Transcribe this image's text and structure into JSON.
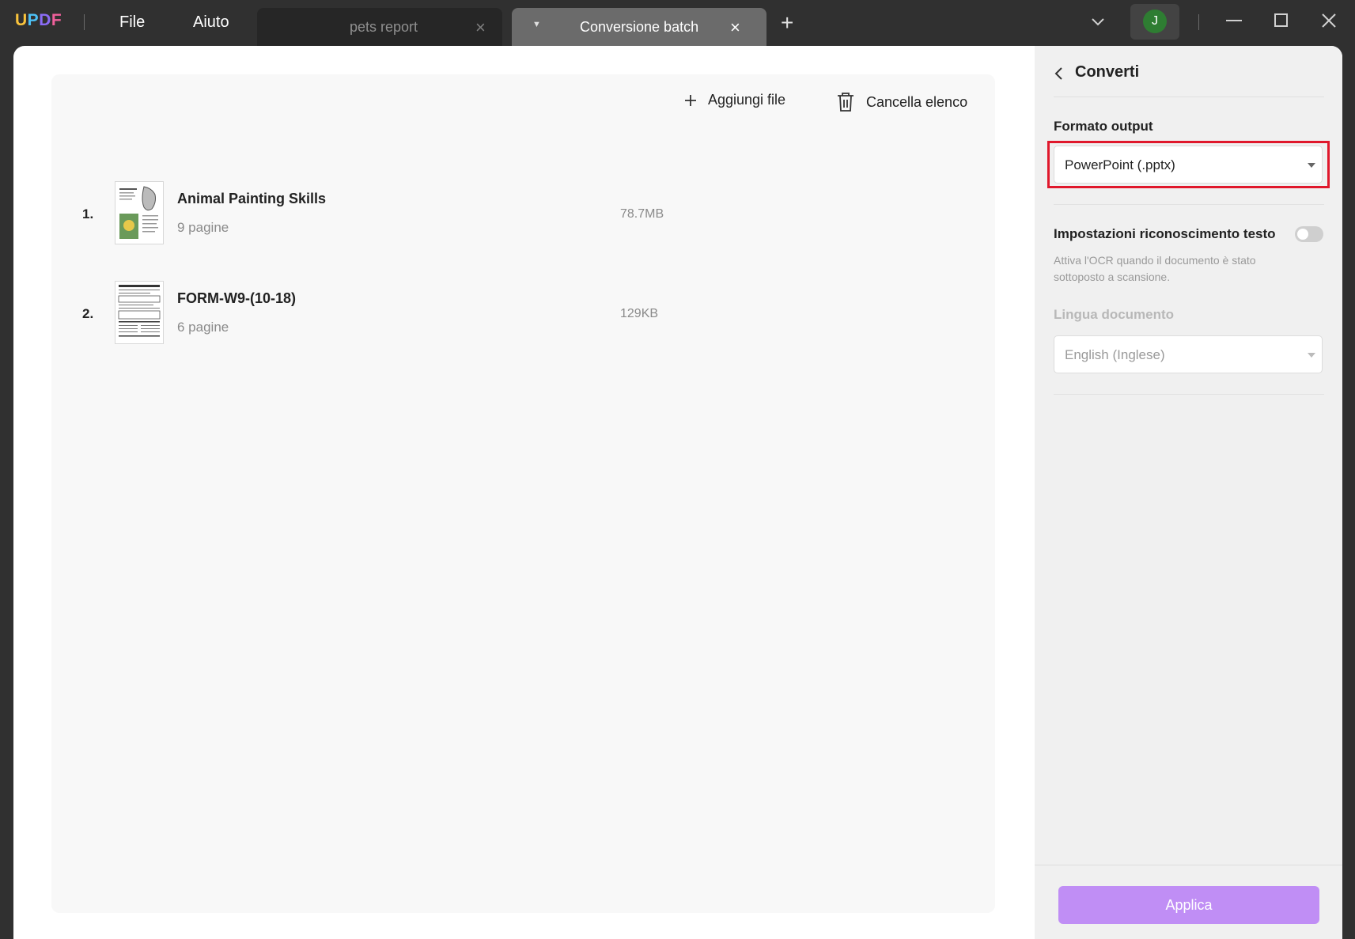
{
  "app": {
    "logo": {
      "u": "U",
      "p": "P",
      "d": "D",
      "f": "F"
    },
    "menu": {
      "file": "File",
      "help": "Aiuto"
    },
    "avatar_initial": "J"
  },
  "tabs": [
    {
      "label": "pets report",
      "close": "×"
    },
    {
      "label": "Conversione batch",
      "close": "×"
    }
  ],
  "new_tab": "+",
  "toolbar": {
    "add": "Aggiungi file",
    "clear": "Cancella elenco"
  },
  "files": [
    {
      "index": "1.",
      "name": "Animal Painting Skills",
      "pages": "9 pagine",
      "size": "78.7MB"
    },
    {
      "index": "2.",
      "name": "FORM-W9-(10-18)",
      "pages": "6 pagine",
      "size": "129KB"
    }
  ],
  "sidebar": {
    "title": "Converti",
    "output_format_label": "Formato output",
    "output_format_value": "PowerPoint (.pptx)",
    "ocr_label": "Impostazioni riconoscimento testo",
    "ocr_enabled": false,
    "ocr_hint": "Attiva l'OCR quando il documento è stato sottoposto a scansione.",
    "language_label": "Lingua documento",
    "language_value": "English (Inglese)",
    "apply": "Applica"
  },
  "colors": {
    "accent": "#c08ef5",
    "highlight": "#e0182c",
    "titlebar": "#303030"
  }
}
